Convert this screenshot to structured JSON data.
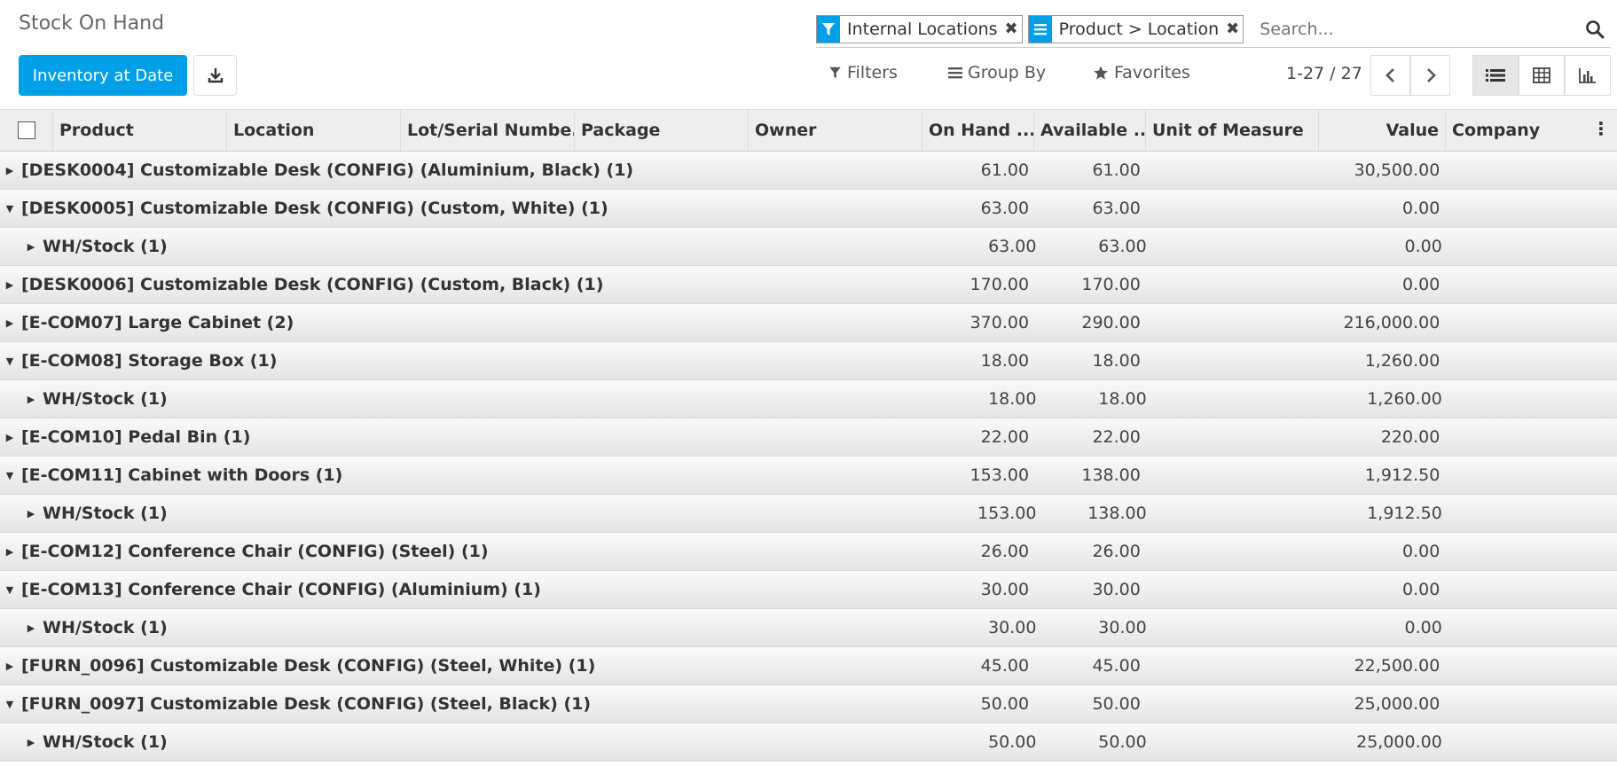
{
  "header": {
    "title": "Stock On Hand",
    "primary_button": "Inventory at Date"
  },
  "search": {
    "facets": [
      {
        "icon": "filter-icon",
        "label": "Internal Locations"
      },
      {
        "icon": "group-by-icon",
        "label": "Product > Location"
      }
    ],
    "placeholder": "Search..."
  },
  "options": {
    "filters": "Filters",
    "group_by": "Group By",
    "favorites": "Favorites"
  },
  "pager": {
    "value": "1-27 / 27"
  },
  "colors": {
    "primary": "#00a0e9"
  },
  "table": {
    "columns": [
      "Product",
      "Location",
      "Lot/Serial Numbe...",
      "Package",
      "Owner",
      "On Hand ...",
      "Available ...",
      "Unit of Measure",
      "Value",
      "Company"
    ],
    "rows": [
      {
        "level": 0,
        "expanded": false,
        "label": "[DESK0004] Customizable Desk (CONFIG) (Aluminium, Black) (1)",
        "on_hand": "61.00",
        "available": "61.00",
        "value": "30,500.00"
      },
      {
        "level": 0,
        "expanded": true,
        "label": "[DESK0005] Customizable Desk (CONFIG) (Custom, White) (1)",
        "on_hand": "63.00",
        "available": "63.00",
        "value": "0.00"
      },
      {
        "level": 1,
        "expanded": false,
        "label": "WH/Stock (1)",
        "on_hand": "63.00",
        "available": "63.00",
        "value": "0.00"
      },
      {
        "level": 0,
        "expanded": false,
        "label": "[DESK0006] Customizable Desk (CONFIG) (Custom, Black) (1)",
        "on_hand": "170.00",
        "available": "170.00",
        "value": "0.00"
      },
      {
        "level": 0,
        "expanded": false,
        "label": "[E-COM07] Large Cabinet (2)",
        "on_hand": "370.00",
        "available": "290.00",
        "value": "216,000.00"
      },
      {
        "level": 0,
        "expanded": true,
        "label": "[E-COM08] Storage Box (1)",
        "on_hand": "18.00",
        "available": "18.00",
        "value": "1,260.00"
      },
      {
        "level": 1,
        "expanded": false,
        "label": "WH/Stock (1)",
        "on_hand": "18.00",
        "available": "18.00",
        "value": "1,260.00"
      },
      {
        "level": 0,
        "expanded": false,
        "label": "[E-COM10] Pedal Bin (1)",
        "on_hand": "22.00",
        "available": "22.00",
        "value": "220.00"
      },
      {
        "level": 0,
        "expanded": true,
        "label": "[E-COM11] Cabinet with Doors (1)",
        "on_hand": "153.00",
        "available": "138.00",
        "value": "1,912.50"
      },
      {
        "level": 1,
        "expanded": false,
        "label": "WH/Stock (1)",
        "on_hand": "153.00",
        "available": "138.00",
        "value": "1,912.50"
      },
      {
        "level": 0,
        "expanded": false,
        "label": "[E-COM12] Conference Chair (CONFIG) (Steel) (1)",
        "on_hand": "26.00",
        "available": "26.00",
        "value": "0.00"
      },
      {
        "level": 0,
        "expanded": true,
        "label": "[E-COM13] Conference Chair (CONFIG) (Aluminium) (1)",
        "on_hand": "30.00",
        "available": "30.00",
        "value": "0.00"
      },
      {
        "level": 1,
        "expanded": false,
        "label": "WH/Stock (1)",
        "on_hand": "30.00",
        "available": "30.00",
        "value": "0.00"
      },
      {
        "level": 0,
        "expanded": false,
        "label": "[FURN_0096] Customizable Desk (CONFIG) (Steel, White) (1)",
        "on_hand": "45.00",
        "available": "45.00",
        "value": "22,500.00"
      },
      {
        "level": 0,
        "expanded": true,
        "label": "[FURN_0097] Customizable Desk (CONFIG) (Steel, Black) (1)",
        "on_hand": "50.00",
        "available": "50.00",
        "value": "25,000.00"
      },
      {
        "level": 1,
        "expanded": false,
        "label": "WH/Stock (1)",
        "on_hand": "50.00",
        "available": "50.00",
        "value": "25,000.00"
      }
    ]
  }
}
